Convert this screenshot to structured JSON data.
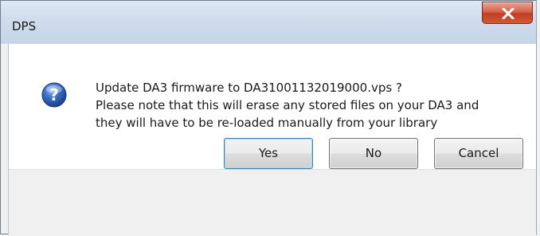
{
  "window": {
    "title": "DPS",
    "close_symbol": "X"
  },
  "icon": {
    "type": "question-icon",
    "symbol": "?",
    "color": "#2a5db0"
  },
  "message": {
    "lines": [
      "Update DA3 firmware to DA31001132019000.vps ?",
      "Please note that this will erase any stored files on your DA3 and",
      "they will have to be re-loaded manually from your library"
    ]
  },
  "buttons": {
    "yes": "Yes",
    "no": "No",
    "cancel": "Cancel"
  },
  "colors": {
    "close_button": "#c23d22",
    "default_button_border": "#3c7fb1"
  }
}
